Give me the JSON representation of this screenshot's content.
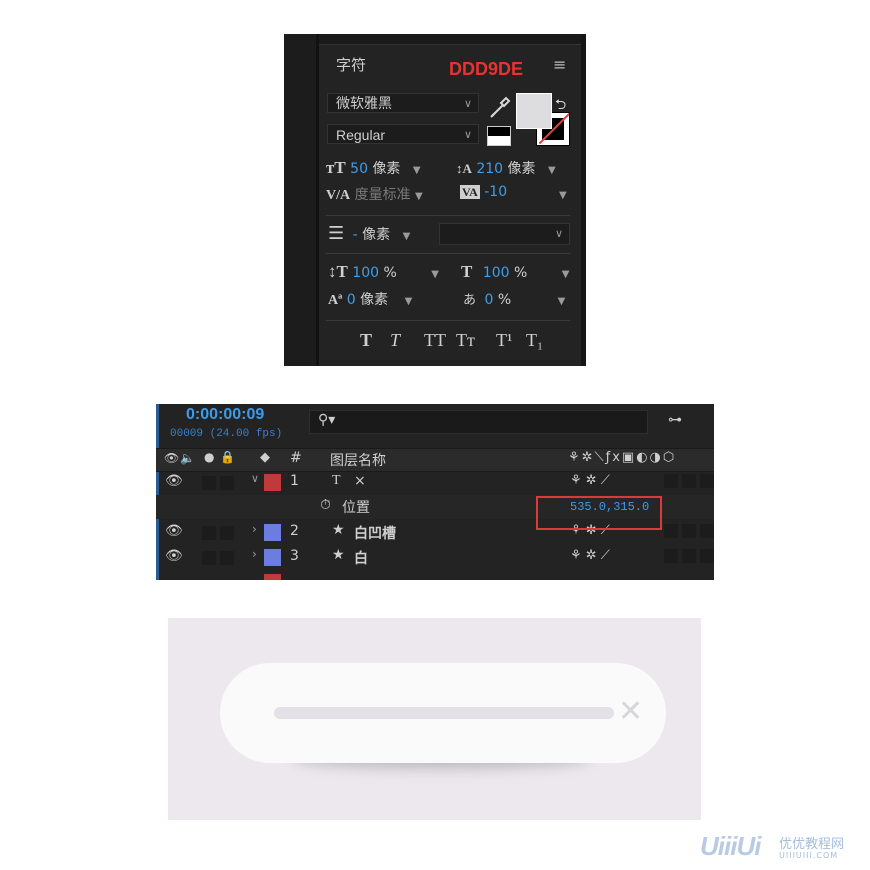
{
  "character_panel": {
    "title": "字符",
    "annotation_hex": "DDD9DE",
    "menu_icon": "hamburger-icon",
    "font_family": "微软雅黑",
    "font_style": "Regular",
    "fill_color": "#dddde0",
    "font_size": "50",
    "font_size_unit": "像素",
    "leading": "210",
    "leading_unit": "像素",
    "kerning": "度量标准",
    "tracking": "-10",
    "stroke_width_value": "-",
    "stroke_width_unit": "像素",
    "vertical_scale": "100",
    "vertical_scale_unit": "%",
    "horizontal_scale": "100",
    "horizontal_scale_unit": "%",
    "baseline_shift": "0",
    "baseline_shift_unit": "像素",
    "tsume": "0",
    "tsume_unit": "%",
    "style_buttons": [
      "T",
      "T",
      "TT",
      "Tт",
      "T¹",
      "T₁"
    ]
  },
  "timeline": {
    "timecode": "0:00:00:09",
    "frames_fps": "00009 (24.00 fps)",
    "header": {
      "num": "#",
      "layer_name": "图层名称"
    },
    "layers": [
      {
        "index": "1",
        "type_icon": "T",
        "name": "×",
        "label_color": "#c0393b",
        "expanded": true
      },
      {
        "index": "2",
        "type_icon": "★",
        "name": "白凹槽",
        "label_color": "#6b7ee0",
        "expanded": false
      },
      {
        "index": "3",
        "type_icon": "★",
        "name": "白",
        "label_color": "#6b7ee0",
        "expanded": false
      }
    ],
    "position_property": {
      "name": "位置",
      "value": "535.0,315.0"
    }
  },
  "watermark": {
    "logo": "UiiiUi",
    "name": "优优教程网",
    "url": "UIIIUIII.COM"
  }
}
